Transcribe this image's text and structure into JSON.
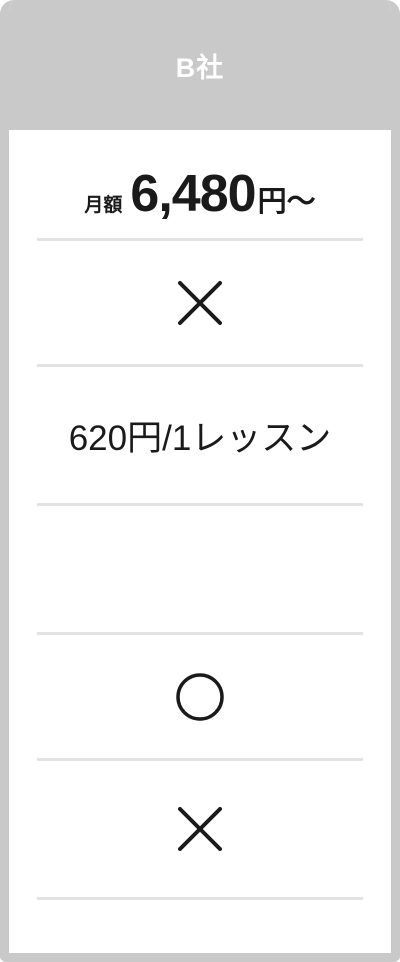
{
  "header": {
    "title": "B社"
  },
  "price": {
    "label": "月額",
    "amount": "6,480",
    "unit": "円〜"
  },
  "rows": {
    "row2_symbol": "cross-icon",
    "lesson_fee": "620円/1レッスン",
    "row5_symbol": "circle-icon",
    "row6_symbol": "cross-icon"
  },
  "colors": {
    "header_bg": "#c9c9c9",
    "divider": "#e3e3e3",
    "text": "#1a1a1a",
    "header_text": "#ffffff"
  }
}
